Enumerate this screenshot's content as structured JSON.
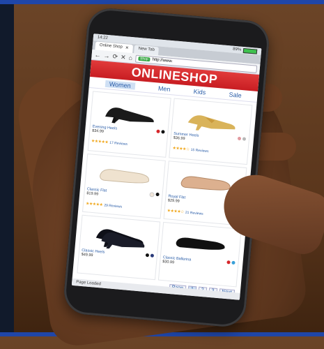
{
  "status_bar": {
    "time": "14:22",
    "battery": "89%"
  },
  "browser": {
    "tabs": [
      {
        "label": "Online Shop",
        "active": true
      },
      {
        "label": "New Tab",
        "active": false
      }
    ],
    "secure_badge": "Shop",
    "url": "http://www.",
    "footer_status": "Page Loaded"
  },
  "shop": {
    "banner": "ONLINESHOP",
    "categories": [
      "Women",
      "Men",
      "Kids",
      "Sale"
    ],
    "active_category": "Women",
    "products": [
      {
        "name": "Evening Heels",
        "price": "$34.99",
        "stars": "★★★★★",
        "reviews": "17 Reviews",
        "swatches": [
          "#d6262a",
          "#111111"
        ]
      },
      {
        "name": "Summer Heels",
        "price": "$36.99",
        "stars": "★★★★☆",
        "reviews": "15 Reviews",
        "swatches": [
          "#e29aa0",
          "#b8b8b8"
        ]
      },
      {
        "name": "Classic Flat",
        "price": "$19.99",
        "stars": "★★★★★",
        "reviews": "29 Reviews",
        "swatches": [
          "#f2e6d9",
          "#111111"
        ]
      },
      {
        "name": "Royal Flat",
        "price": "$29.99",
        "stars": "★★★★☆",
        "reviews": "21 Reviews",
        "swatches": [
          "#e0b899",
          "#111111"
        ]
      },
      {
        "name": "Classic Heels",
        "price": "$49.99",
        "stars": "",
        "reviews": "",
        "swatches": [
          "#111111",
          "#2a3a7a"
        ]
      },
      {
        "name": "Classic Ballerina",
        "price": "$30.99",
        "stars": "",
        "reviews": "",
        "swatches": [
          "#d6262a",
          "#39a0d8"
        ]
      }
    ],
    "pager": {
      "label": "Page",
      "pages": [
        "1",
        "2",
        "3"
      ],
      "current": "1",
      "next": "Next"
    }
  },
  "colors": {
    "banner": "#d9272d",
    "link": "#2a5da8",
    "accent_tab": "#cfe0f4"
  }
}
